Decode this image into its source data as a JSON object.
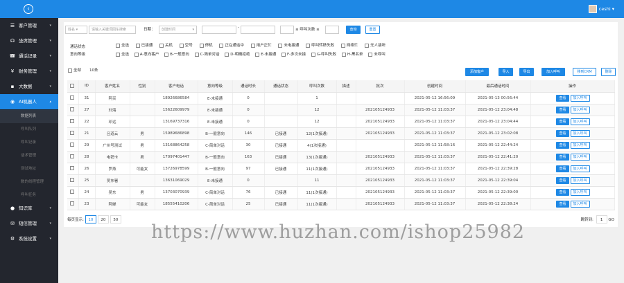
{
  "sidebar": {
    "collapse_icon": "chevron-left-icon",
    "items": [
      {
        "label": "客户管理",
        "icon": "list-icon"
      },
      {
        "label": "坐席管理",
        "icon": "headset-icon"
      },
      {
        "label": "通话记录",
        "icon": "phone-icon"
      },
      {
        "label": "财务管理",
        "icon": "yen-icon"
      },
      {
        "label": "大数据",
        "icon": "briefcase-icon"
      },
      {
        "label": "AI机器人",
        "icon": "robot-icon"
      },
      {
        "label": "知识库",
        "icon": "circle-icon"
      },
      {
        "label": "短信管理",
        "icon": "message-icon"
      },
      {
        "label": "系统设置",
        "icon": "gear-icon"
      }
    ],
    "subitems": [
      "数据列表",
      "呼叫队列",
      "呼叫记录",
      "话术管理",
      "测试地址",
      "数的线程管理",
      "呼叫任务"
    ]
  },
  "header": {
    "username": "ceshi",
    "dropdown": "▾"
  },
  "filters": {
    "select1": "姓名",
    "keyword_placeholder": "请输入关键词回车搜索",
    "date_label": "日期：",
    "date_select": "创建时间",
    "range_sep": "-",
    "calls_label": "≤ 呼叫次数 ≤",
    "search_btn": "查询",
    "reset_btn": "重置"
  },
  "status_row": {
    "label": "通话状态",
    "options": [
      "全选",
      "已接通",
      "关机",
      "空号",
      "停机",
      "正在通话中",
      "用户正忙",
      "未电接通",
      "呼叫转移失败",
      "网络忙",
      "无人接听"
    ]
  },
  "level_row": {
    "label": "意向等级",
    "options": [
      "全选",
      "A-意向客户",
      "B-一般意向",
      "C-简单对话",
      "D-明确拒绝",
      "E-未接通",
      "F-多次未接",
      "G-呼叫失败",
      "H-黑名单",
      "未呼叫"
    ]
  },
  "toolbar": {
    "select_all": "全部",
    "count": "10条",
    "buttons": [
      "添加客户",
      "导入",
      "导出",
      "加入呼叫",
      "移到CRM",
      "删除"
    ]
  },
  "table": {
    "headers": [
      "",
      "ID",
      "客户姓名",
      "性别",
      "客户电话",
      "意向等级",
      "通话时长",
      "通话状态",
      "呼叫次数",
      "描述",
      "批次",
      "创建时间",
      "最后通话时间",
      "操作"
    ],
    "rows": [
      [
        "31",
        "阿买",
        "",
        "18926686584",
        "E-未接通",
        "0",
        "",
        "1",
        "",
        "",
        "2021-05-12 16:56:09",
        "2021-05-13 00:56:44"
      ],
      [
        "27",
        "刘海",
        "",
        "15622609979",
        "E-未接通",
        "0",
        "",
        "12",
        "",
        "202105124933",
        "2021-05-12 11:03:37",
        "2021-05-12 23:04:48"
      ],
      [
        "22",
        "邓远",
        "",
        "13169737316",
        "E-未接通",
        "0",
        "",
        "12",
        "",
        "202105124933",
        "2021-05-12 11:03:37",
        "2021-05-12 23:04:44"
      ],
      [
        "21",
        "吕道云",
        "男",
        "15989686898",
        "B-一般意向",
        "146",
        "已接通",
        "12(1次接通)",
        "",
        "202105124933",
        "2021-05-12 11:03:37",
        "2021-05-12 23:02:08"
      ],
      [
        "29",
        "广州号测试",
        "男",
        "13168864258",
        "C-简单对话",
        "30",
        "已接通",
        "4(1次接通)",
        "",
        "",
        "2021-05-12 11:58:16",
        "2021-05-12 22:44:24"
      ],
      [
        "28",
        "电销卡",
        "男",
        "17097401447",
        "B-一般意向",
        "163",
        "已接通",
        "13(1次接通)",
        "",
        "202105124933",
        "2021-05-12 11:03:37",
        "2021-05-12 22:41:20"
      ],
      [
        "26",
        "罗燕",
        "可能女",
        "13726978599",
        "B-一般意向",
        "97",
        "已接通",
        "11(1次接通)",
        "",
        "202105124933",
        "2021-05-12 11:03:37",
        "2021-05-12 22:39:28"
      ],
      [
        "25",
        "吴东署",
        "",
        "13631069029",
        "E-未接通",
        "0",
        "",
        "11",
        "",
        "202105124933",
        "2021-05-12 11:03:37",
        "2021-05-12 22:39:04"
      ],
      [
        "24",
        "吴东",
        "男",
        "13703070939",
        "C-简单对话",
        "76",
        "已接通",
        "11(1次接通)",
        "",
        "202105124933",
        "2021-05-12 11:03:37",
        "2021-05-12 22:39:00"
      ],
      [
        "23",
        "阿婵",
        "可能女",
        "18555410206",
        "C-简单对话",
        "25",
        "已接通",
        "11(1次接通)",
        "",
        "202105124933",
        "2021-05-12 11:03:37",
        "2021-05-12 22:38:24"
      ]
    ],
    "action_edit": "查看",
    "action_call": "加入呼叫"
  },
  "pager": {
    "label": "每页显示:",
    "sizes": [
      "10",
      "20",
      "50"
    ],
    "jump_label": "跳转到:",
    "jump_value": "1",
    "go": "GO"
  },
  "watermark": "https://www.huzhan.com/ishop25982",
  "colors": {
    "accent": "#1e88e5",
    "sidebar": "#23262e"
  }
}
